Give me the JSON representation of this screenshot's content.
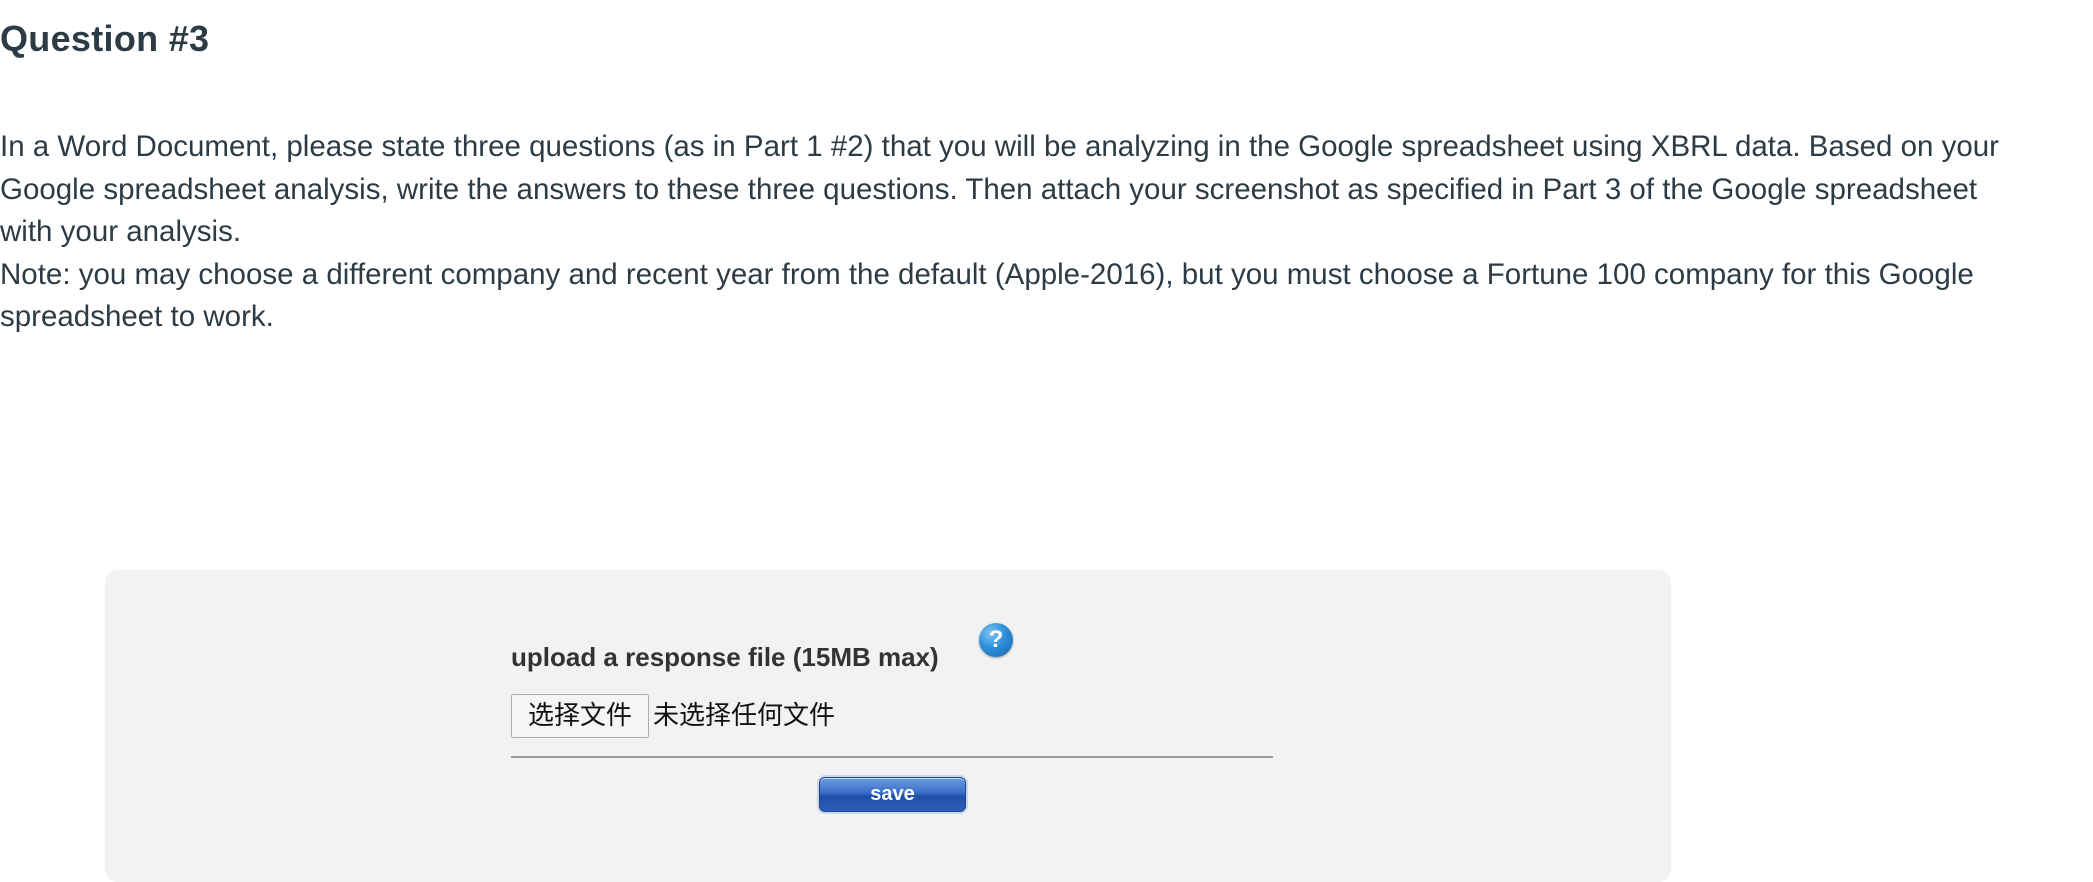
{
  "question": {
    "title": "Question #3",
    "paragraph_1": "In a Word Document, please state three questions (as in Part 1 #2) that you will be analyzing in the Google spreadsheet using XBRL data. Based on your Google spreadsheet analysis, write the answers to these three questions. Then attach your screenshot as specified in Part 3 of the Google spreadsheet with your analysis.",
    "paragraph_2": "Note: you may choose a different company and recent year from the default (Apple-2016), but you must choose a Fortune 100 company for this Google spreadsheet to work."
  },
  "upload": {
    "label": "upload a response file (15MB max)",
    "help_icon": "question-mark-icon",
    "help_icon_glyph": "?",
    "choose_file_label": "选择文件",
    "file_status": "未选择任何文件",
    "save_label": "save"
  },
  "colors": {
    "panel_background": "#f2f2f2",
    "text": "#2d3b45",
    "save_button": "#2c5cb7",
    "help_icon": "#2d8fd8"
  }
}
